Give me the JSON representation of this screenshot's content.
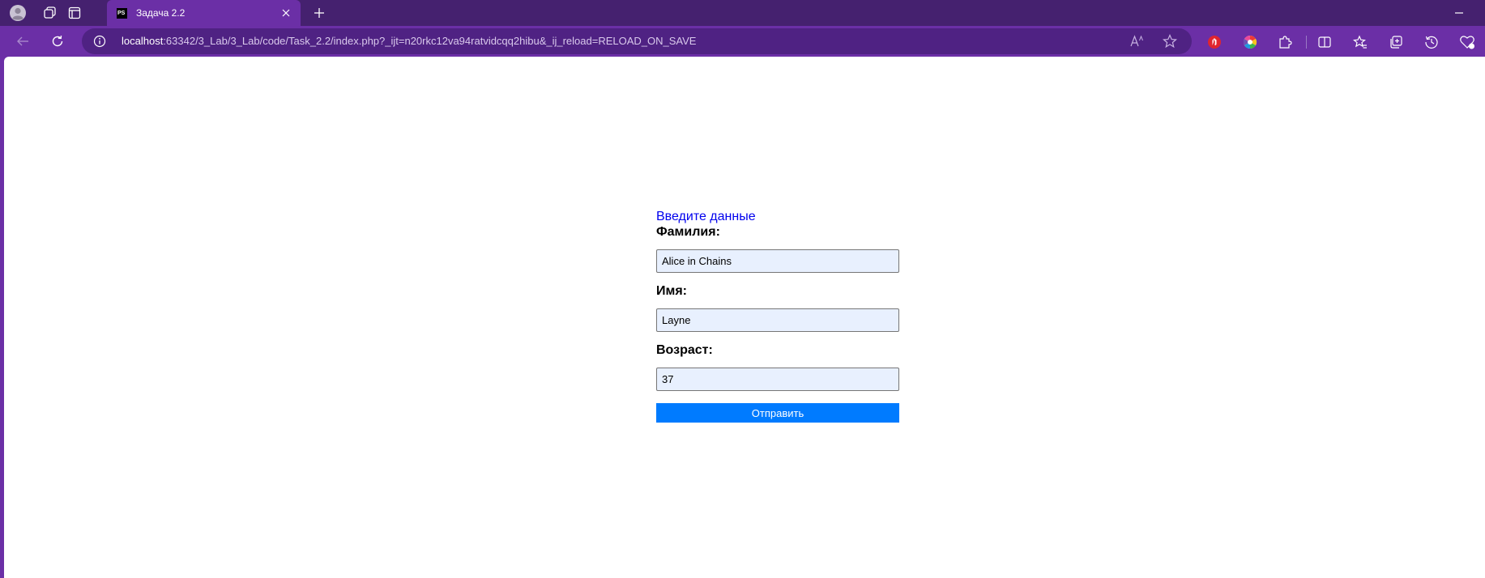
{
  "browser": {
    "tab": {
      "title": "Задача 2.2",
      "favicon_text": "PS"
    },
    "address": {
      "host": "localhost",
      "path": ":63342/3_Lab/3_Lab/code/Task_2.2/index.php?_ijt=n20rkc12va94ratvidcqq2hibu&_ij_reload=RELOAD_ON_SAVE"
    },
    "accent_color": "#6b2fa6",
    "titlebar_color": "#45216f"
  },
  "page": {
    "heading": "Введите данные",
    "fields": [
      {
        "label": "Фамилия:",
        "value": "Alice in Chains"
      },
      {
        "label": "Имя:",
        "value": "Layne"
      },
      {
        "label": "Возраст:",
        "value": "37"
      }
    ],
    "submit_label": "Отправить",
    "submit_color": "#007bff",
    "input_bg": "#e8f0fe"
  }
}
